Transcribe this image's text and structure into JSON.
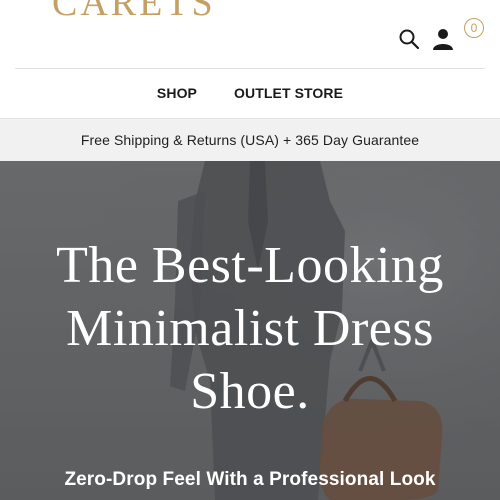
{
  "header": {
    "logo_text": "CARETS",
    "cart_count": "0",
    "nav": [
      {
        "label": "SHOP"
      },
      {
        "label": "OUTLET STORE"
      }
    ],
    "icons": [
      "search-icon",
      "account-icon",
      "cart-icon"
    ]
  },
  "announcement": {
    "text": "Free Shipping & Returns (USA) + 365 Day Guarantee"
  },
  "hero": {
    "headline": "The Best-Looking Minimalist Dress Shoe.",
    "subheadline": "Zero-Drop Feel With a Professional Look"
  },
  "colors": {
    "brand_gold": "#c4a064",
    "hero_overlay": "#5f6061",
    "announcement_bg": "#f1f1f1"
  }
}
